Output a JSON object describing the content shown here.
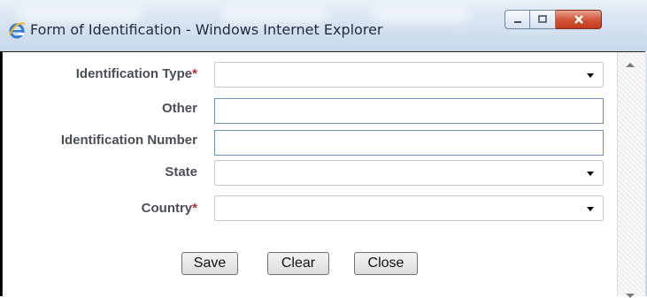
{
  "window": {
    "title": "Form of Identification - Windows Internet Explorer",
    "icon": "ie-icon",
    "caption_buttons": [
      "minimize-icon",
      "maximize-icon",
      "close-icon"
    ]
  },
  "form": {
    "identification_type": {
      "label": "Identification Type",
      "required_mark": "*",
      "value": ""
    },
    "other": {
      "label": "Other",
      "value": ""
    },
    "identification_number": {
      "label": "Identification Number",
      "value": ""
    },
    "state": {
      "label": "State",
      "value": ""
    },
    "country": {
      "label": "Country",
      "required_mark": "*",
      "value": ""
    }
  },
  "buttons": {
    "save": "Save",
    "clear": "Clear",
    "close": "Close"
  },
  "colors": {
    "required": "#c0282d",
    "label": "#4a4f57",
    "close_button": "#c8452a"
  }
}
